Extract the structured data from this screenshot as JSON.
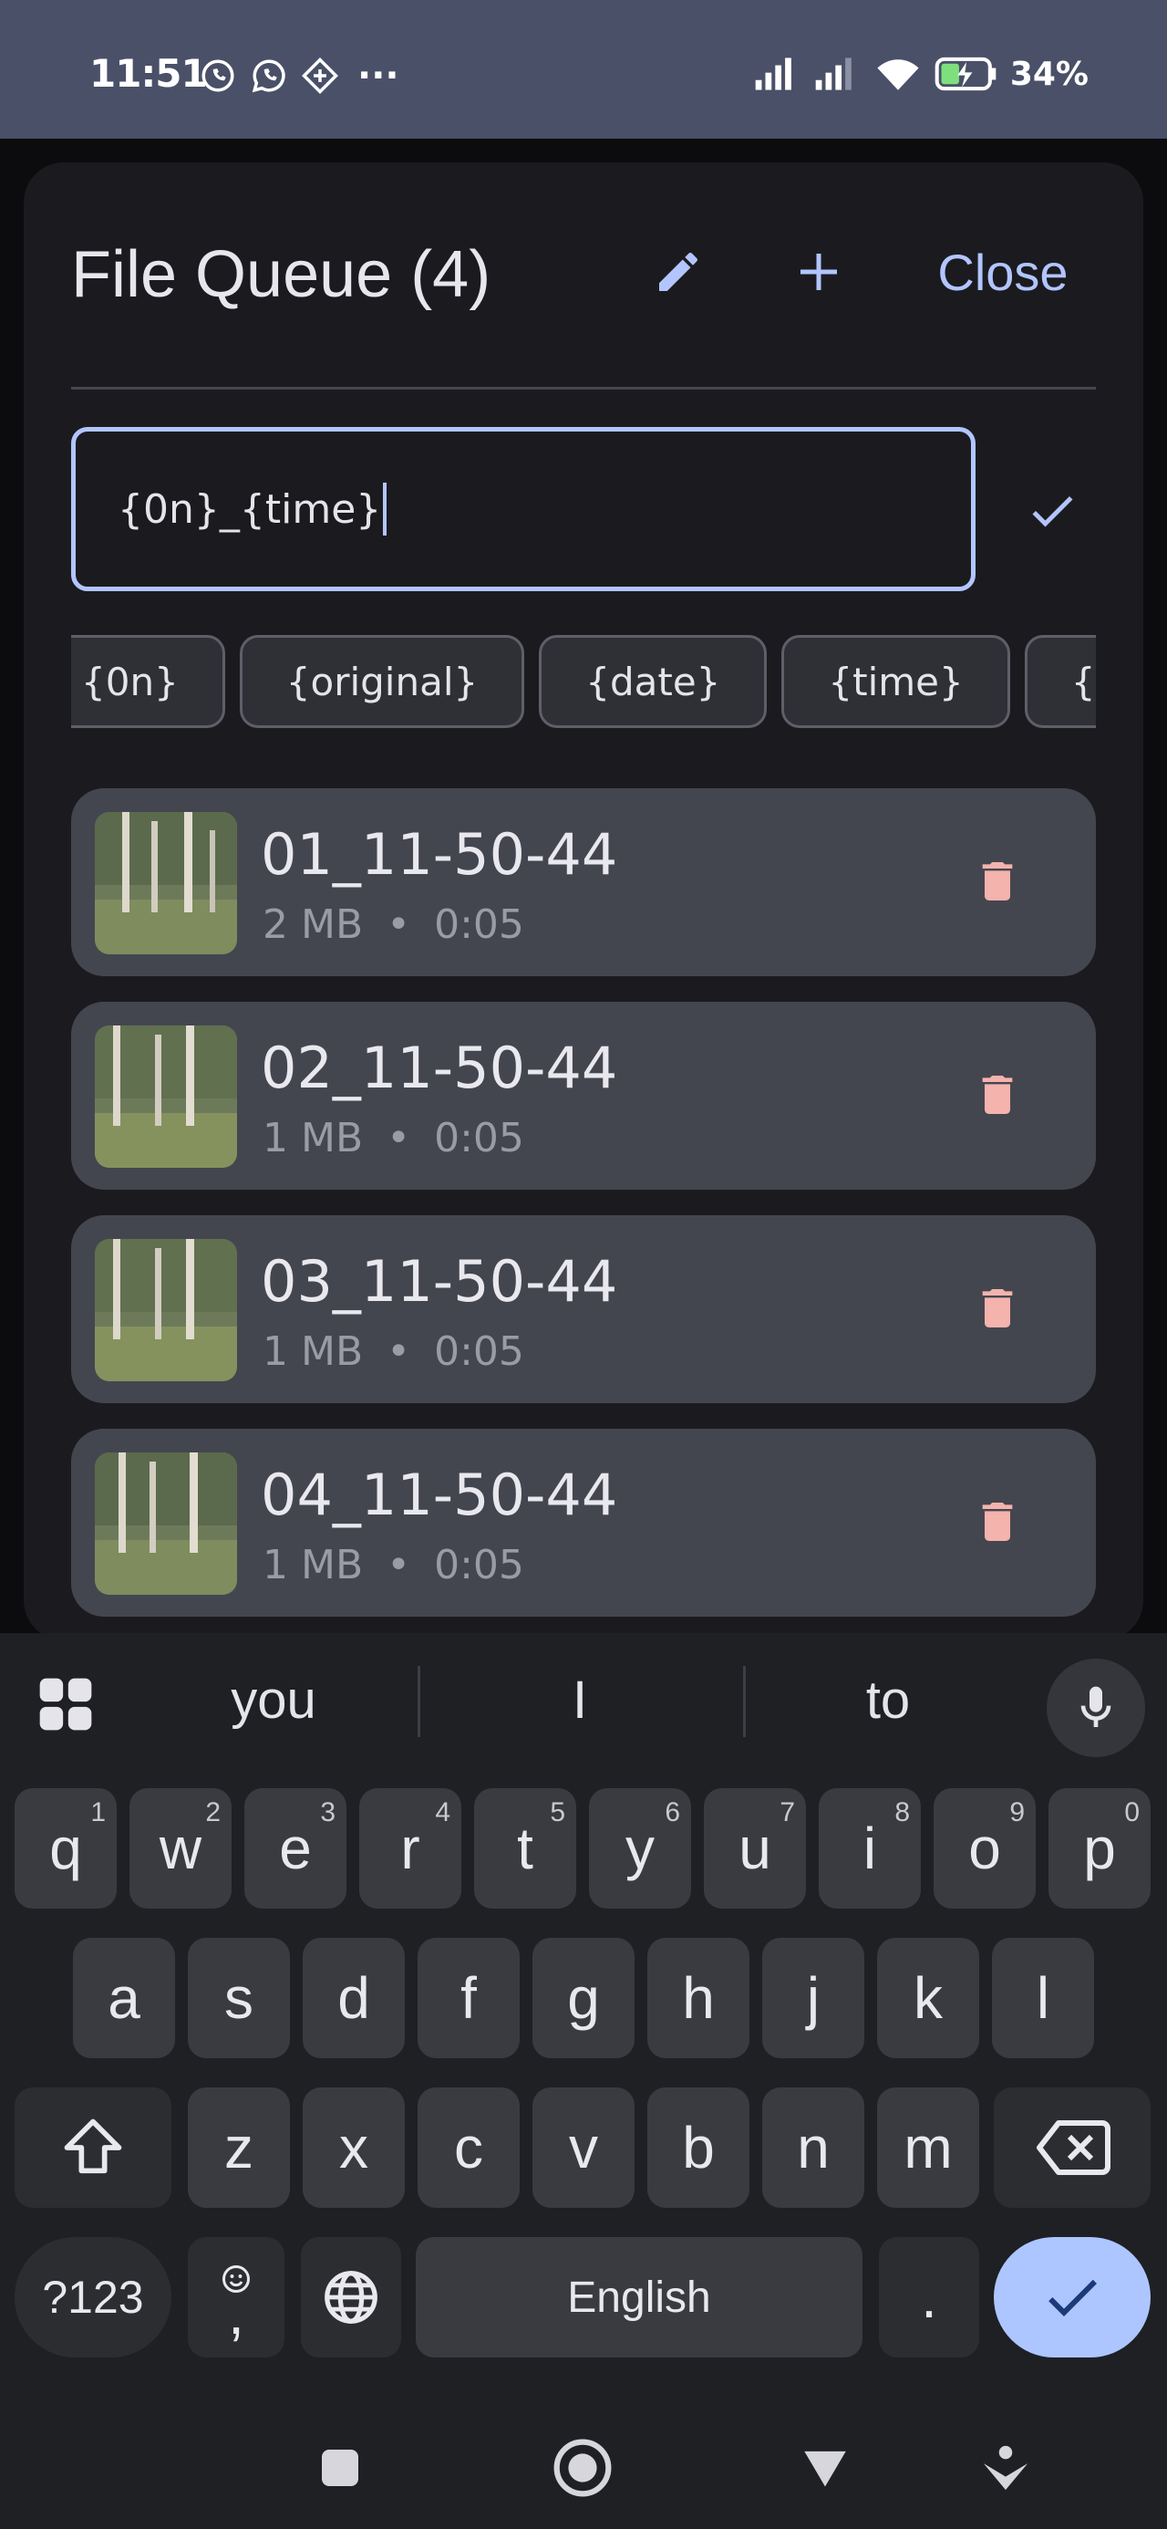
{
  "status_bar": {
    "time": "11:51",
    "left_icons": [
      "viber-icon",
      "whatsapp-icon",
      "diamond-app-icon"
    ],
    "more": "···",
    "battery": "34%"
  },
  "sheet": {
    "title": "File Queue (4)",
    "close_label": "Close",
    "name_template_value": "{0n}_{time}",
    "accent_color": "#b2c5ff",
    "chips": [
      "{0n}",
      "{original}",
      "{date}",
      "{time}",
      "{datetime}"
    ],
    "files": [
      {
        "name": "01_11-50-44",
        "size": "2 MB",
        "duration": "0:05"
      },
      {
        "name": "02_11-50-44",
        "size": "1 MB",
        "duration": "0:05"
      },
      {
        "name": "03_11-50-44",
        "size": "1 MB",
        "duration": "0:05"
      },
      {
        "name": "04_11-50-44",
        "size": "1 MB",
        "duration": "0:05"
      }
    ],
    "meta_separator": "•",
    "delete_color": "#f4b3ad"
  },
  "keyboard": {
    "suggestions": [
      "you",
      "I",
      "to"
    ],
    "row1": [
      {
        "k": "q",
        "n": "1"
      },
      {
        "k": "w",
        "n": "2"
      },
      {
        "k": "e",
        "n": "3"
      },
      {
        "k": "r",
        "n": "4"
      },
      {
        "k": "t",
        "n": "5"
      },
      {
        "k": "y",
        "n": "6"
      },
      {
        "k": "u",
        "n": "7"
      },
      {
        "k": "i",
        "n": "8"
      },
      {
        "k": "o",
        "n": "9"
      },
      {
        "k": "p",
        "n": "0"
      }
    ],
    "row2": [
      "a",
      "s",
      "d",
      "f",
      "g",
      "h",
      "j",
      "k",
      "l"
    ],
    "row3": [
      "z",
      "x",
      "c",
      "v",
      "b",
      "n",
      "m"
    ],
    "symbols_label": "?123",
    "emoji_comma_label": ",",
    "space_label": "English",
    "period_label": "."
  }
}
